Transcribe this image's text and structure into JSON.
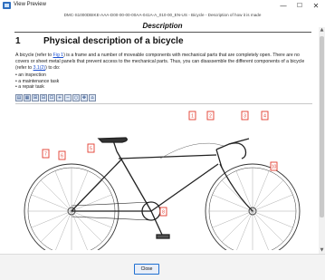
{
  "window": {
    "title": "View Preview",
    "minimize_icon": "minimize-icon",
    "maximize_icon": "maximize-icon",
    "close_icon": "close-icon"
  },
  "document": {
    "code": "DMC-S1000DBIKE-AAA-D00-00-00-00AA-041A-A_010-00_EN-US - Bicycle - Description of how it is made",
    "heading": "Description",
    "section_number": "1",
    "section_title": "Physical description of a bicycle",
    "paragraph": {
      "part1": "A bicycle (refer to ",
      "link1": "Fig 1",
      "part2": ") is a frame and a number of moveable components with mechanical parts that are completely open. There are no covers or sheet metal panels that prevent access to the mechanical parts. Thus, you can disassemble the different components of a bicycle (refer to ",
      "link2": "3.1(2)",
      "part3": ") to do:"
    },
    "bullets": [
      "an inspection",
      "a maintenance task",
      "a repair task"
    ]
  },
  "figure_toolbar": {
    "buttons": [
      {
        "name": "print-icon",
        "glyph": "▤"
      },
      {
        "name": "grid-icon",
        "glyph": "▦"
      },
      {
        "name": "fit-page-icon",
        "glyph": "⊞"
      },
      {
        "name": "fit-width-icon",
        "glyph": "⊟"
      },
      {
        "name": "zoom-area-icon",
        "glyph": "⊡"
      },
      {
        "name": "zoom-in-icon",
        "glyph": "+"
      },
      {
        "name": "zoom-out-icon",
        "glyph": "−"
      },
      {
        "name": "zoom-reset-icon",
        "glyph": "○"
      },
      {
        "name": "pan-icon",
        "glyph": "✥"
      },
      {
        "name": "home-icon",
        "glyph": "⌂"
      }
    ]
  },
  "callouts": [
    "7",
    "6",
    "5",
    "8",
    "1",
    "2",
    "3",
    "4",
    "10"
  ],
  "colors": {
    "callout": "#e23b2e",
    "link": "#1a4fd1",
    "close_border": "#1f6fd1"
  },
  "footer": {
    "close_label": "Close"
  }
}
